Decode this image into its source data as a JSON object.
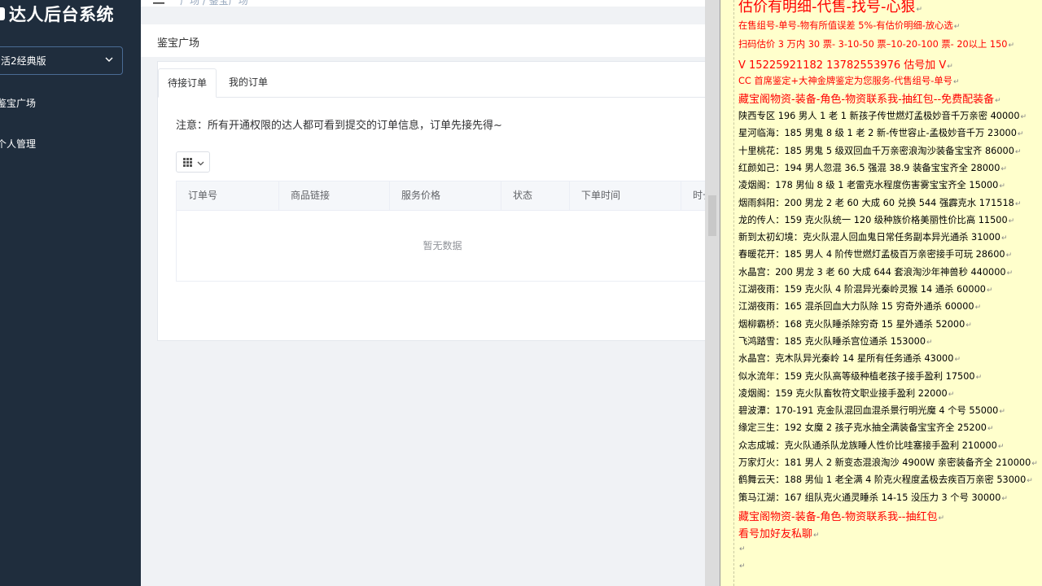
{
  "app": {
    "title": "达人后台系统"
  },
  "sidebar": {
    "selector_value": "活2经典版",
    "items": [
      {
        "label": "鉴宝广场"
      },
      {
        "label": "个人管理"
      }
    ]
  },
  "header": {
    "breadcrumb": "广场 / 鉴宝广场"
  },
  "page": {
    "title": "鉴宝广场"
  },
  "tabs": [
    {
      "label": "待接订单",
      "active": true
    },
    {
      "label": "我的订单",
      "active": false
    }
  ],
  "notice": "注意：所有开通权限的达人都可看到提交的订单信息，订单先接先得~",
  "table": {
    "columns": [
      "订单号",
      "商品链接",
      "服务价格",
      "状态",
      "下单时间",
      "时长"
    ],
    "empty_text": "暂无数据"
  },
  "document": {
    "lines": [
      {
        "text": "估价有明细-代售-找号-心狠",
        "color": "red",
        "size": "big"
      },
      {
        "text": "在售组号-单号-物有所值误差 5%-有估价明细-放心选",
        "color": "red"
      },
      {
        "text": "扫码估价 3 万内 30 票- 3-10-50 票–10-20-100 票- 20以上 150",
        "color": "red"
      },
      {
        "text": "V 15225921182   13782553976   估号加 V",
        "color": "red",
        "size": "mid"
      },
      {
        "text": "CC 首席鉴定+大神金牌鉴定为您服务-代售组号-单号",
        "color": "red"
      },
      {
        "text": "藏宝阁物资-装备-角色-物资联系我-抽红包--免费配装备",
        "color": "red",
        "size": "mid"
      },
      {
        "text": "陕西专区 196 男人 1 老 1 新孩子传世燃灯孟极妙音千万亲密 40000",
        "color": "black"
      },
      {
        "text": "星河临海：185 男鬼 8 级 1 老 2 新-传世容止-孟极妙音千万 23000",
        "color": "black"
      },
      {
        "text": "十里桃花：185 男鬼 5 级双回血千万亲密浪淘沙装备宝宝齐 86000",
        "color": "black"
      },
      {
        "text": "红颜如己：194 男人忽混 36.5 强混 38.9 装备宝宝齐全 28000",
        "color": "black"
      },
      {
        "text": "凌烟阁：178 男仙 8 级 1 老雷克水程度伤害雾宝宝齐全 15000",
        "color": "black"
      },
      {
        "text": "烟雨斜阳：200 男龙 2 老 60 大成 60 兑换 544 强霹克水 171518",
        "color": "black"
      },
      {
        "text": "龙的传人：159 克火队统一 120 级种族价格美丽性价比高 11500",
        "color": "black"
      },
      {
        "text": "新到太初幻境：克火队混人回血鬼日常任务副本异光通杀 31000",
        "color": "black"
      },
      {
        "text": "春暖花开：185 男人 4 阶传世燃灯孟极百万亲密接手可玩 28600",
        "color": "black"
      },
      {
        "text": "水晶宫：200 男龙 3 老 60 大成 644 套浪淘沙年神兽秒 440000",
        "color": "black"
      },
      {
        "text": "江湖夜雨：159 克火队 4 阶混异光秦岭灵猴 14 通杀 60000",
        "color": "black"
      },
      {
        "text": "江湖夜雨：165 混杀回血大力队除 15 穷奇外通杀 60000",
        "color": "black"
      },
      {
        "text": "烟柳霸桥：168 克火队睡杀除穷奇 15 星外通杀 52000",
        "color": "black"
      },
      {
        "text": "飞鸿踏雪：185 克火队睡杀宫位通杀 153000",
        "color": "black"
      },
      {
        "text": "水晶宫：克木队异光秦岭 14 星所有任务通杀 43000",
        "color": "black"
      },
      {
        "text": "似水流年：159 克火队高等级种植老孩子接手盈利 17500",
        "color": "black"
      },
      {
        "text": "凌烟阁：159 克火队畜牧符文职业接手盈利 22000",
        "color": "black"
      },
      {
        "text": "碧波潭：170-191 克金队混回血混杀景行明光魔 4 个号 55000",
        "color": "black"
      },
      {
        "text": "缘定三生：192 女魔 2 孩子克水抽全满装备宝宝齐全 25200",
        "color": "black"
      },
      {
        "text": "众志成城：克火队通杀队龙族睡人性价比哇塞接手盈利 210000",
        "color": "black"
      },
      {
        "text": "万家灯火：181 男人 2 新变态混浪淘沙 4900W 亲密装备齐全 210000",
        "color": "black"
      },
      {
        "text": "鹤舞云天：188 男仙 1 老全满 4 阶克火程度孟极去疾百万亲密 53000",
        "color": "black"
      },
      {
        "text": "策马江湖：167 组队克火通灵睡杀 14-15 没压力 3 个号 30000",
        "color": "black"
      },
      {
        "text": "藏宝阁物资-装备-角色-物资联系我--抽红包",
        "color": "red",
        "size": "mid"
      },
      {
        "text": "看号加好友私聊",
        "color": "red",
        "size": "mid"
      },
      {
        "text": "",
        "color": "black"
      },
      {
        "text": "",
        "color": "black"
      }
    ]
  }
}
